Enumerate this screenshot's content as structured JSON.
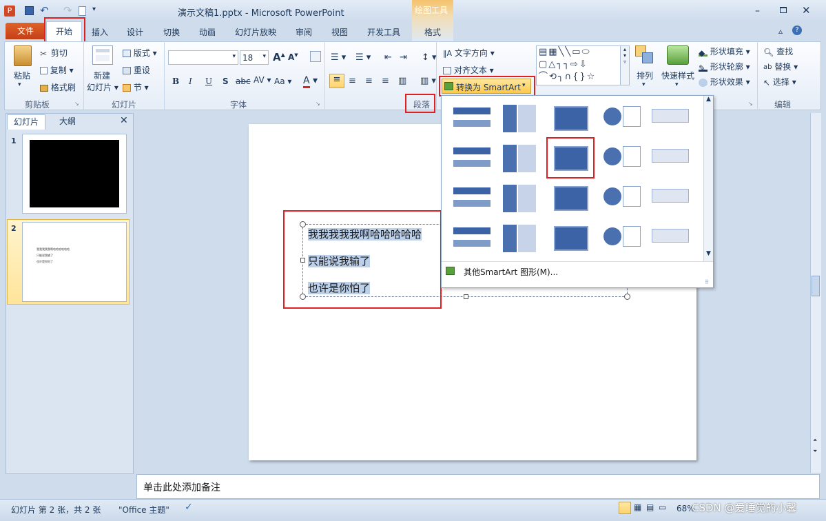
{
  "window": {
    "filename": "演示文稿1.pptx",
    "separator": "-",
    "app_name": "Microsoft PowerPoint",
    "context_tab_group": "绘图工具"
  },
  "tabs": [
    "文件",
    "开始",
    "插入",
    "设计",
    "切换",
    "动画",
    "幻灯片放映",
    "审阅",
    "视图",
    "开发工具",
    "格式"
  ],
  "clipboard": {
    "paste": "粘贴",
    "cut": "剪切",
    "copy": "复制",
    "format_painter": "格式刷",
    "label": "剪贴板"
  },
  "slides_group": {
    "new_slide_line1": "新建",
    "new_slide_line2": "幻灯片",
    "layout": "版式",
    "reset": "重设",
    "section": "节",
    "label": "幻灯片"
  },
  "font_group": {
    "font_size": "18",
    "label": "字体"
  },
  "paragraph_group": {
    "text_direction": "文字方向",
    "align_text": "对齐文本",
    "convert_smartart": "转换为 SmartArt",
    "label": "段落"
  },
  "drawing_group": {
    "arrange": "排列",
    "quick_styles": "快速样式",
    "shape_fill": "形状填充",
    "shape_outline": "形状轮廓",
    "shape_effects": "形状效果"
  },
  "editing_group": {
    "find": "查找",
    "replace": "替换",
    "select": "选择",
    "label": "编辑"
  },
  "gallery": {
    "more": "其他SmartArt 图形(M)..."
  },
  "pane_tabs": {
    "slides": "幻灯片",
    "outline": "大纲"
  },
  "thumbnails": [
    {
      "num": "1"
    },
    {
      "num": "2",
      "lines": [
        "我我我我我啊哈哈哈哈哈哈",
        "只能说我输了",
        "也许是你怕了"
      ]
    }
  ],
  "slide_text": [
    "我我我我我啊哈哈哈哈哈",
    "只能说我输了",
    "也许是你怕了"
  ],
  "notes_placeholder": "单击此处添加备注",
  "status": {
    "slide_info": "幻灯片 第 2 张，共 2 张",
    "theme": "\"Office 主题\"",
    "zoom": "68%",
    "watermark": "CSDN @爱睡觉的小馨"
  }
}
